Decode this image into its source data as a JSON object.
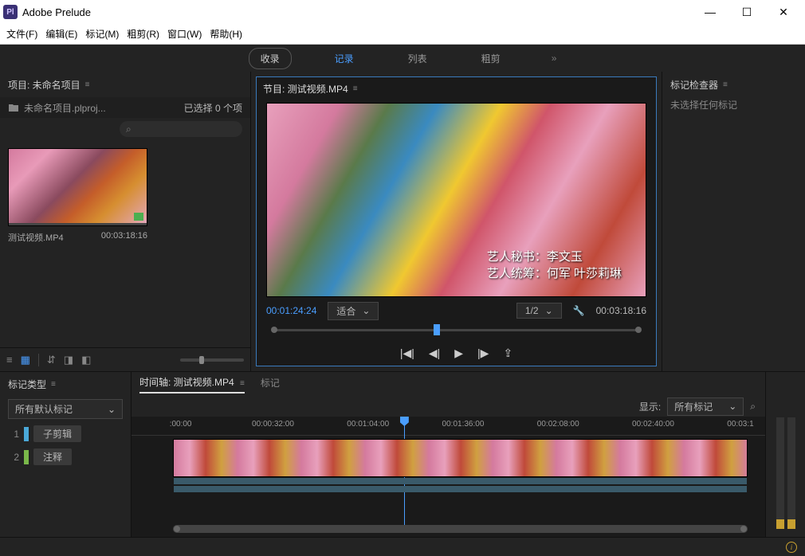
{
  "titlebar": {
    "app_name": "Adobe Prelude"
  },
  "menubar": [
    "文件(F)",
    "编辑(E)",
    "标记(M)",
    "粗剪(R)",
    "窗口(W)",
    "帮助(H)"
  ],
  "toptabs": {
    "ingest": "收录",
    "logging": "记录",
    "list": "列表",
    "roughcut": "粗剪"
  },
  "project": {
    "title": "项目: 未命名项目",
    "file": "未命名项目.plproj...",
    "selected": "已选择 0 个项",
    "clip_name": "测试视频.MP4",
    "clip_duration": "00:03:18:16"
  },
  "monitor": {
    "title": "节目: 测试视频.MP4",
    "caption1": "艺人秘书：李文玉",
    "caption2": "艺人统筹：何军  叶莎莉琳",
    "tc_current": "00:01:24:24",
    "fit": "适合",
    "resolution": "1/2",
    "tc_duration": "00:03:18:16"
  },
  "marker_inspector": {
    "title": "标记检查器",
    "empty": "未选择任何标记"
  },
  "marker_types": {
    "title": "标记类型",
    "dropdown": "所有默认标记",
    "items": [
      {
        "num": "1",
        "color": "#4aa8d8",
        "label": "子剪辑"
      },
      {
        "num": "2",
        "color": "#7ab84a",
        "label": "注释"
      }
    ]
  },
  "timeline": {
    "title": "时间轴: 测试视频.MP4",
    "tab_marker": "标记",
    "show_label": "显示:",
    "show_dd": "所有标记",
    "ticks": [
      {
        "pos": 6,
        "label": ":00:00"
      },
      {
        "pos": 19,
        "label": "00:00:32:00"
      },
      {
        "pos": 34,
        "label": "00:01:04:00"
      },
      {
        "pos": 49,
        "label": "00:01:36:00"
      },
      {
        "pos": 64,
        "label": "00:02:08:00"
      },
      {
        "pos": 79,
        "label": "00:02:40:00"
      },
      {
        "pos": 94,
        "label": "00:03:1"
      }
    ]
  }
}
